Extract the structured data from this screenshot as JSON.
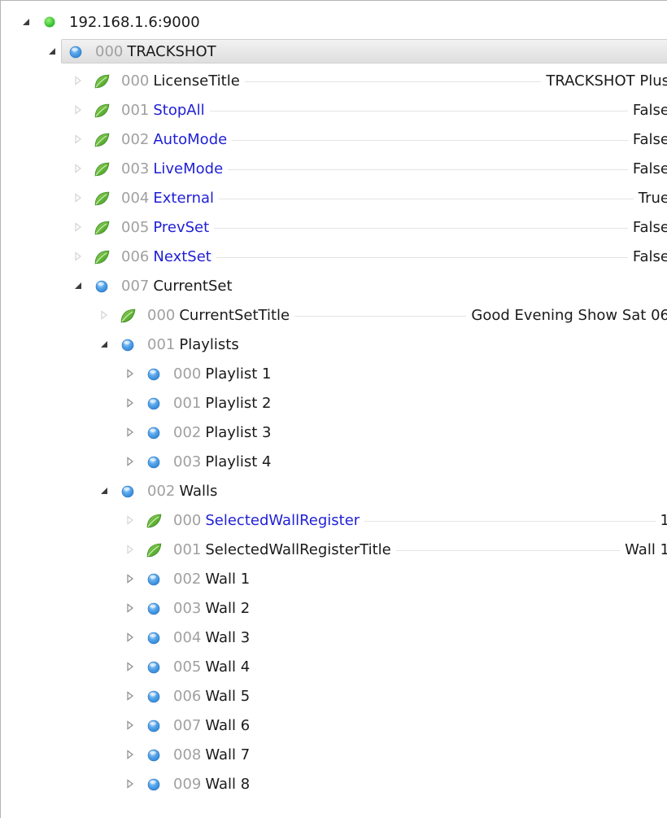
{
  "tree": [
    {
      "depth": 0,
      "expander": "expanded",
      "icon": "status-green-dot",
      "label": "192.168.1.6:9000",
      "root": true
    },
    {
      "depth": 1,
      "expander": "expanded",
      "icon": "node-blue-sphere",
      "num": "000",
      "name": "TRACKSHOT",
      "selected": true
    },
    {
      "depth": 2,
      "expander": "leaf",
      "icon": "parameter-leaf",
      "num": "000",
      "name": "LicenseTitle",
      "value": "TRACKSHOT Plus"
    },
    {
      "depth": 2,
      "expander": "leaf",
      "icon": "parameter-leaf",
      "num": "001",
      "name": "StopAll",
      "writable": true,
      "value": "False"
    },
    {
      "depth": 2,
      "expander": "leaf",
      "icon": "parameter-leaf",
      "num": "002",
      "name": "AutoMode",
      "writable": true,
      "value": "False"
    },
    {
      "depth": 2,
      "expander": "leaf",
      "icon": "parameter-leaf",
      "num": "003",
      "name": "LiveMode",
      "writable": true,
      "value": "False"
    },
    {
      "depth": 2,
      "expander": "leaf",
      "icon": "parameter-leaf",
      "num": "004",
      "name": "External",
      "writable": true,
      "value": "True"
    },
    {
      "depth": 2,
      "expander": "leaf",
      "icon": "parameter-leaf",
      "num": "005",
      "name": "PrevSet",
      "writable": true,
      "value": "False"
    },
    {
      "depth": 2,
      "expander": "leaf",
      "icon": "parameter-leaf",
      "num": "006",
      "name": "NextSet",
      "writable": true,
      "value": "False"
    },
    {
      "depth": 2,
      "expander": "expanded",
      "icon": "node-blue-sphere",
      "num": "007",
      "name": "CurrentSet"
    },
    {
      "depth": 3,
      "expander": "leaf",
      "icon": "parameter-leaf",
      "num": "000",
      "name": "CurrentSetTitle",
      "value": "Good Evening Show Sat 06"
    },
    {
      "depth": 3,
      "expander": "expanded",
      "icon": "node-blue-sphere",
      "num": "001",
      "name": "Playlists"
    },
    {
      "depth": 4,
      "expander": "collapsed",
      "icon": "node-blue-sphere",
      "num": "000",
      "name": "Playlist 1"
    },
    {
      "depth": 4,
      "expander": "collapsed",
      "icon": "node-blue-sphere",
      "num": "001",
      "name": "Playlist 2"
    },
    {
      "depth": 4,
      "expander": "collapsed",
      "icon": "node-blue-sphere",
      "num": "002",
      "name": "Playlist 3"
    },
    {
      "depth": 4,
      "expander": "collapsed",
      "icon": "node-blue-sphere",
      "num": "003",
      "name": "Playlist 4"
    },
    {
      "depth": 3,
      "expander": "expanded",
      "icon": "node-blue-sphere",
      "num": "002",
      "name": "Walls"
    },
    {
      "depth": 4,
      "expander": "leaf",
      "icon": "parameter-leaf",
      "num": "000",
      "name": "SelectedWallRegister",
      "writable": true,
      "value": "1"
    },
    {
      "depth": 4,
      "expander": "leaf",
      "icon": "parameter-leaf",
      "num": "001",
      "name": "SelectedWallRegisterTitle",
      "value": "Wall 1"
    },
    {
      "depth": 4,
      "expander": "collapsed",
      "icon": "node-blue-sphere",
      "num": "002",
      "name": "Wall 1"
    },
    {
      "depth": 4,
      "expander": "collapsed",
      "icon": "node-blue-sphere",
      "num": "003",
      "name": "Wall 2"
    },
    {
      "depth": 4,
      "expander": "collapsed",
      "icon": "node-blue-sphere",
      "num": "004",
      "name": "Wall 3"
    },
    {
      "depth": 4,
      "expander": "collapsed",
      "icon": "node-blue-sphere",
      "num": "005",
      "name": "Wall 4"
    },
    {
      "depth": 4,
      "expander": "collapsed",
      "icon": "node-blue-sphere",
      "num": "006",
      "name": "Wall 5"
    },
    {
      "depth": 4,
      "expander": "collapsed",
      "icon": "node-blue-sphere",
      "num": "007",
      "name": "Wall 6"
    },
    {
      "depth": 4,
      "expander": "collapsed",
      "icon": "node-blue-sphere",
      "num": "008",
      "name": "Wall 7"
    },
    {
      "depth": 4,
      "expander": "collapsed",
      "icon": "node-blue-sphere",
      "num": "009",
      "name": "Wall 8"
    }
  ],
  "colors": {
    "writable_name": "#1f1fd6",
    "index_number": "#a0a0a0",
    "status_green": "#22b822",
    "sphere_blue": "#2e86d6",
    "leaf_green": "#3e9a1e"
  }
}
